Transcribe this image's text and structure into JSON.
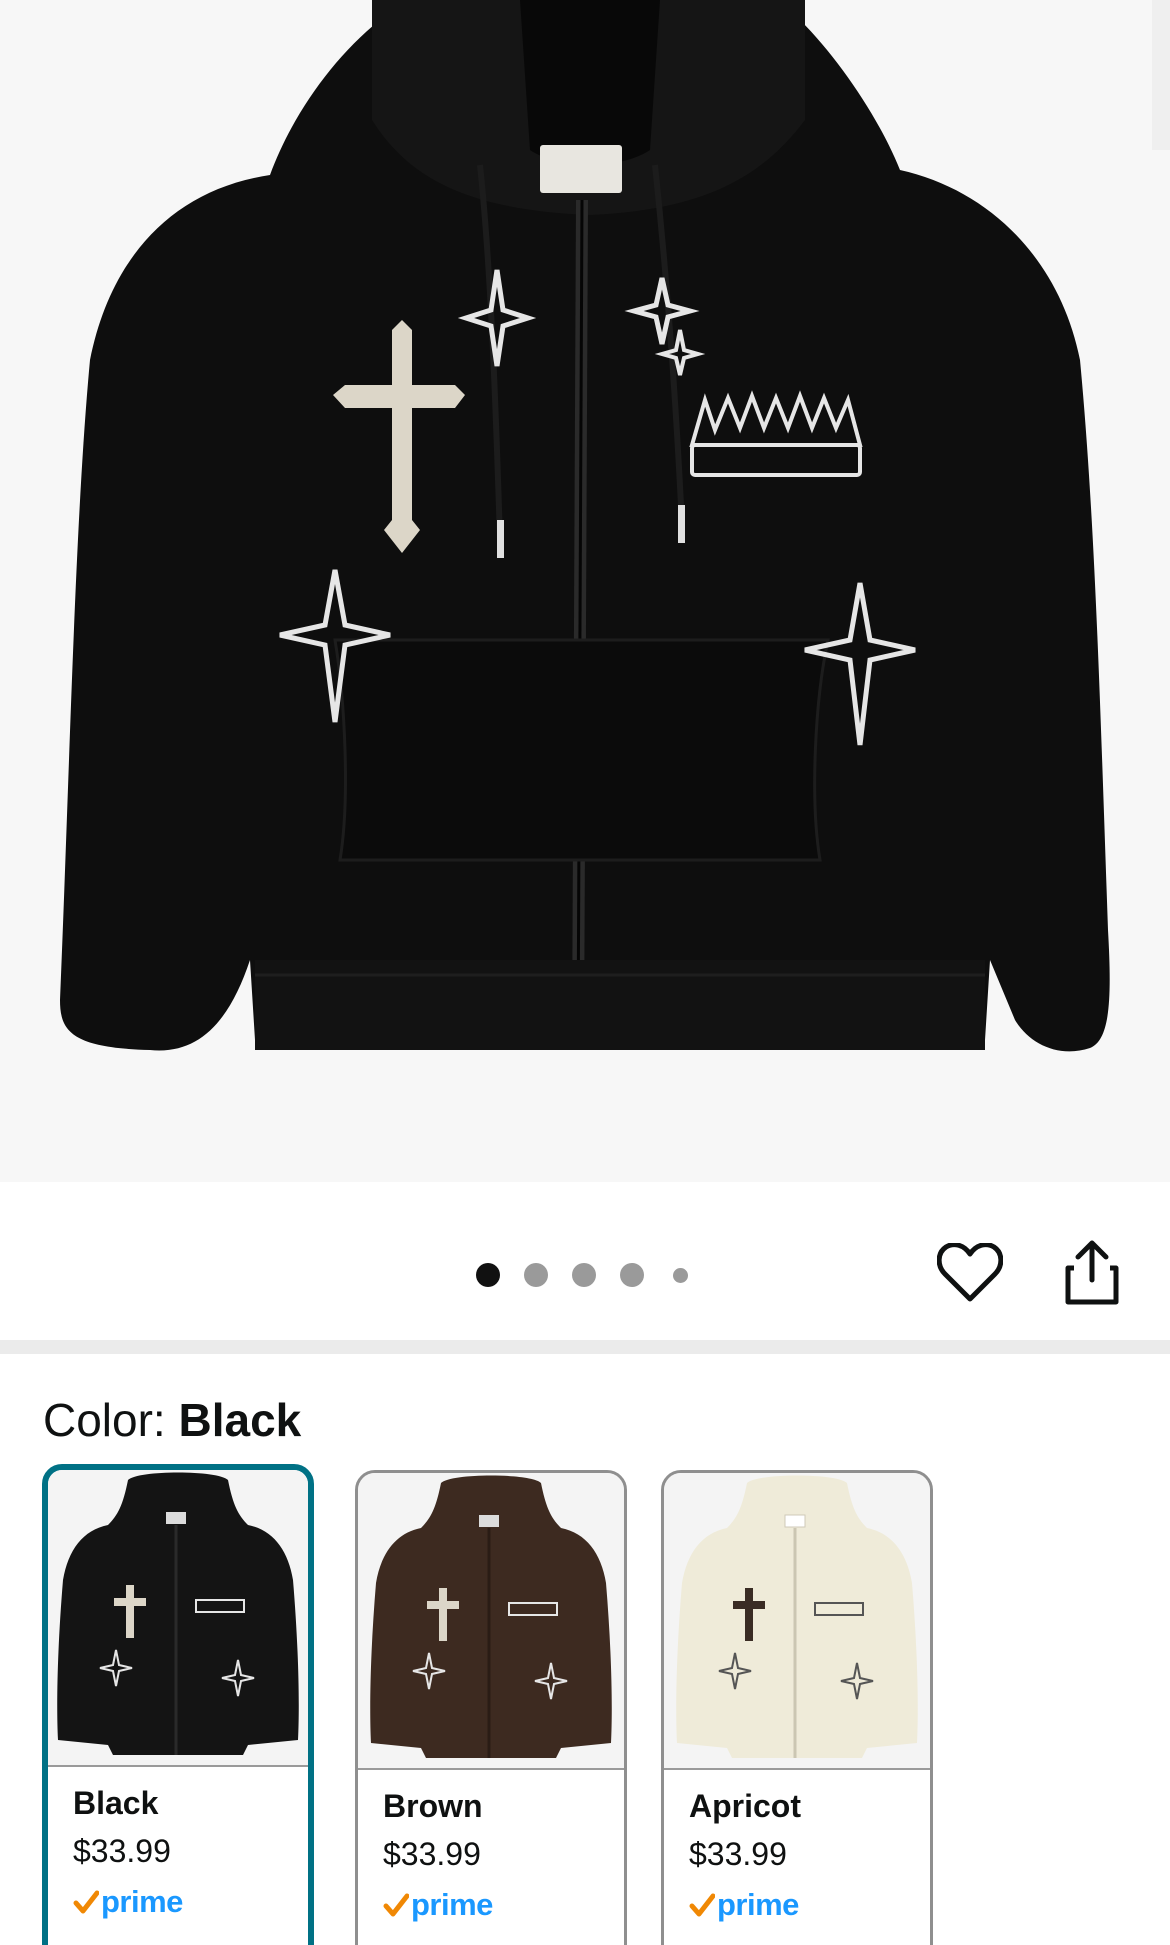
{
  "product": {
    "image_dots": {
      "total": 5,
      "active_index": 0
    }
  },
  "actions": {
    "wishlist_icon": "heart-icon",
    "share_icon": "share-icon"
  },
  "color": {
    "label": "Color:",
    "selected": "Black"
  },
  "swatches": [
    {
      "name": "Black",
      "price": "$33.99",
      "badge": "prime",
      "color_hex": "#141414",
      "selected": true
    },
    {
      "name": "Brown",
      "price": "$33.99",
      "badge": "prime",
      "color_hex": "#3d2a20",
      "selected": false
    },
    {
      "name": "Apricot",
      "price": "$33.99",
      "badge": "prime",
      "color_hex": "#efebd9",
      "selected": false
    }
  ],
  "colors": {
    "accent": "#007185",
    "prime_blue": "#1a98ff",
    "prime_check": "#f08804"
  }
}
